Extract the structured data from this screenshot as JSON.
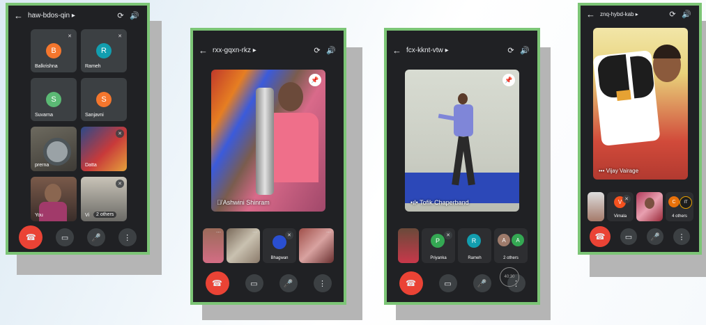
{
  "phones": [
    {
      "meeting_code": "haw-bdos-qin",
      "tiles": [
        {
          "initial": "B",
          "name": "Balkrishna",
          "color": "#f4762d"
        },
        {
          "initial": "R",
          "name": "Rameh",
          "color": "#129eaf"
        },
        {
          "initial": "S",
          "name": "Suvarna",
          "color": "#5bb974"
        },
        {
          "initial": "S",
          "name": "Sanjavni",
          "color": "#f4762d"
        }
      ],
      "video_tiles": [
        {
          "name": "prerna"
        },
        {
          "name": "Datta"
        },
        {
          "name": "You"
        },
        {
          "name": "Vi"
        }
      ],
      "others_label": "2 others"
    },
    {
      "meeting_code": "rxx-gqxn-rkz",
      "main_name": "Ashwini Shinram",
      "strip": [
        {
          "name": ""
        },
        {
          "name": ""
        },
        {
          "name": "Bhagwan"
        },
        {
          "name": ""
        }
      ]
    },
    {
      "meeting_code": "fcx-kknt-vtw",
      "main_name": "Tofik Chaperband",
      "strip": [
        {
          "name": "",
          "initial": ""
        },
        {
          "name": "Priyanka",
          "initial": "P",
          "color": "#34a853"
        },
        {
          "name": "Rameh",
          "initial": "R",
          "color": "#129eaf"
        },
        {
          "name": "2 others",
          "initial": "A",
          "color": "#9e7b6b"
        }
      ],
      "others_second_initial": "A",
      "timer": "40:30"
    },
    {
      "meeting_code": "znq-hybd-kab",
      "main_name": "Vijay Vairage",
      "strip": [
        {
          "name": "",
          "initial": ""
        },
        {
          "name": "Vimala",
          "initial": "V",
          "color": "#f4511e"
        },
        {
          "name": "",
          "initial": ""
        },
        {
          "name": "4 others",
          "initial": "C",
          "color": "#e8710a"
        }
      ],
      "others_second_initial": "IT"
    }
  ],
  "icons": {
    "back": "←",
    "chevron": "▸",
    "camera_flip": "⟳",
    "speaker": "🔊",
    "end_call": "☎",
    "video": "▭",
    "mic": "🎤",
    "more": "⋮",
    "pin": "📌",
    "mute": "✕"
  },
  "colors": {
    "frame": "#7cc576",
    "surface": "#202124",
    "end_call": "#ea4335"
  }
}
